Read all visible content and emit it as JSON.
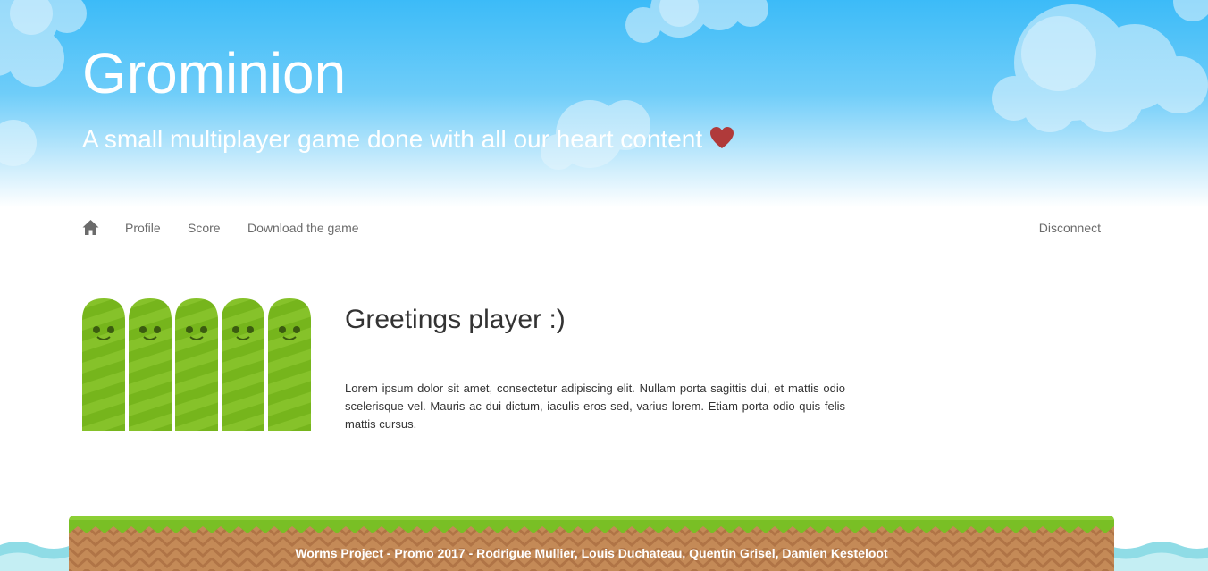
{
  "header": {
    "title": "Grominion",
    "tagline": "A small multiplayer game done with all our heart content",
    "tagline_icon": "heart-icon",
    "heart_color": "#b03a3a"
  },
  "nav": {
    "home_icon": "home-icon",
    "items": [
      {
        "label": "Profile"
      },
      {
        "label": "Score"
      },
      {
        "label": "Download the game"
      }
    ],
    "right_item": {
      "label": "Disconnect"
    }
  },
  "main": {
    "worm_count": 5,
    "worm_color": "#7fbf23",
    "greeting": "Greetings player :)",
    "paragraph": "Lorem ipsum dolor sit amet, consectetur adipiscing elit. Nullam porta sagittis dui, et mattis odio scelerisque vel. Mauris ac dui dictum, iaculis eros sed, varius lorem. Etiam porta odio quis felis mattis cursus."
  },
  "footer": {
    "credits": "Worms Project - Promo 2017 - Rodrigue Mullier, Louis Duchateau, Quentin Grisel, Damien Kesteloot",
    "grass_color": "#79bf25",
    "dirt_color": "#c48a57"
  },
  "colors": {
    "sky_top": "#3cbbf8",
    "nav_text": "#6b6b6b",
    "body_text": "#333333",
    "water": "#8fdce6"
  }
}
